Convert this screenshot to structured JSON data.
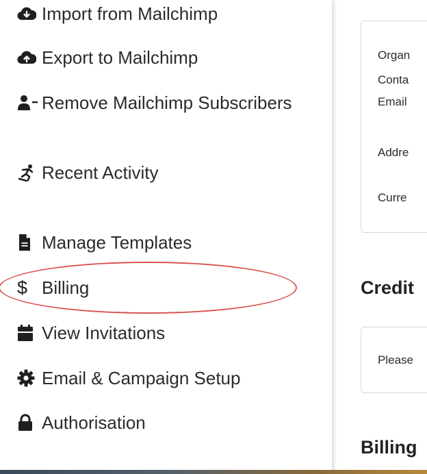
{
  "sidebar": {
    "items": [
      {
        "label": "Import from Mailchimp",
        "icon": "cloud-download-icon"
      },
      {
        "label": "Export to Mailchimp",
        "icon": "cloud-upload-icon"
      },
      {
        "label": "Remove Mailchimp Subscribers",
        "icon": "user-minus-icon"
      },
      {
        "label": "Recent Activity",
        "icon": "skater-icon"
      },
      {
        "label": "Manage Templates",
        "icon": "file-icon"
      },
      {
        "label": "Billing",
        "icon": "dollar-icon",
        "highlighted": true
      },
      {
        "label": "View Invitations",
        "icon": "calendar-icon"
      },
      {
        "label": "Email & Campaign Setup",
        "icon": "gear-icon"
      },
      {
        "label": "Authorisation",
        "icon": "lock-icon"
      }
    ]
  },
  "content": {
    "details_card": {
      "lines": [
        "Organ",
        "Conta",
        "Email",
        "Addre",
        "Curre"
      ]
    },
    "credit_heading": "Credit",
    "credit_card": {
      "text": "Please"
    },
    "billing_heading": "Billing"
  },
  "colors": {
    "highlight": "#d9534f",
    "card_border": "#d6d6d6"
  }
}
